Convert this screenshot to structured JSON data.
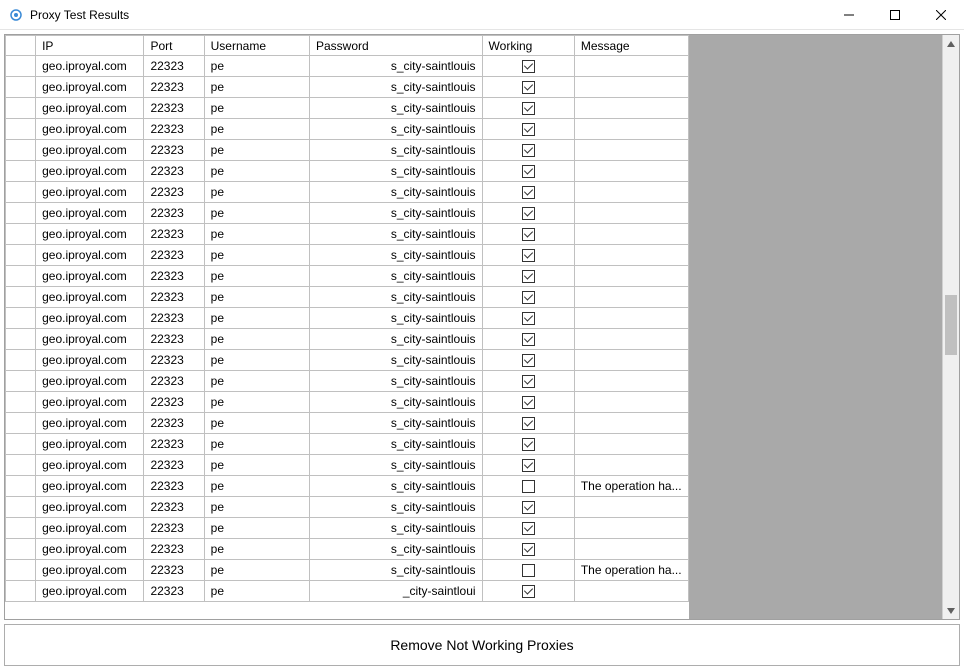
{
  "window": {
    "title": "Proxy Test Results"
  },
  "table": {
    "headers": {
      "ip": "IP",
      "port": "Port",
      "username": "Username",
      "password": "Password",
      "working": "Working",
      "message": "Message"
    },
    "rows": [
      {
        "ip": "geo.iproyal.com",
        "port": "22323",
        "username_visible": "pe",
        "password_visible": "s_city-saintlouis",
        "working": true,
        "message": ""
      },
      {
        "ip": "geo.iproyal.com",
        "port": "22323",
        "username_visible": "pe",
        "password_visible": "s_city-saintlouis",
        "working": true,
        "message": ""
      },
      {
        "ip": "geo.iproyal.com",
        "port": "22323",
        "username_visible": "pe",
        "password_visible": "s_city-saintlouis",
        "working": true,
        "message": ""
      },
      {
        "ip": "geo.iproyal.com",
        "port": "22323",
        "username_visible": "pe",
        "password_visible": "s_city-saintlouis",
        "working": true,
        "message": ""
      },
      {
        "ip": "geo.iproyal.com",
        "port": "22323",
        "username_visible": "pe",
        "password_visible": "s_city-saintlouis",
        "working": true,
        "message": ""
      },
      {
        "ip": "geo.iproyal.com",
        "port": "22323",
        "username_visible": "pe",
        "password_visible": "s_city-saintlouis",
        "working": true,
        "message": ""
      },
      {
        "ip": "geo.iproyal.com",
        "port": "22323",
        "username_visible": "pe",
        "password_visible": "s_city-saintlouis",
        "working": true,
        "message": ""
      },
      {
        "ip": "geo.iproyal.com",
        "port": "22323",
        "username_visible": "pe",
        "password_visible": "s_city-saintlouis",
        "working": true,
        "message": ""
      },
      {
        "ip": "geo.iproyal.com",
        "port": "22323",
        "username_visible": "pe",
        "password_visible": "s_city-saintlouis",
        "working": true,
        "message": ""
      },
      {
        "ip": "geo.iproyal.com",
        "port": "22323",
        "username_visible": "pe",
        "password_visible": "s_city-saintlouis",
        "working": true,
        "message": ""
      },
      {
        "ip": "geo.iproyal.com",
        "port": "22323",
        "username_visible": "pe",
        "password_visible": "s_city-saintlouis",
        "working": true,
        "message": ""
      },
      {
        "ip": "geo.iproyal.com",
        "port": "22323",
        "username_visible": "pe",
        "password_visible": "s_city-saintlouis",
        "working": true,
        "message": ""
      },
      {
        "ip": "geo.iproyal.com",
        "port": "22323",
        "username_visible": "pe",
        "password_visible": "s_city-saintlouis",
        "working": true,
        "message": ""
      },
      {
        "ip": "geo.iproyal.com",
        "port": "22323",
        "username_visible": "pe",
        "password_visible": "s_city-saintlouis",
        "working": true,
        "message": ""
      },
      {
        "ip": "geo.iproyal.com",
        "port": "22323",
        "username_visible": "pe",
        "password_visible": "s_city-saintlouis",
        "working": true,
        "message": ""
      },
      {
        "ip": "geo.iproyal.com",
        "port": "22323",
        "username_visible": "pe",
        "password_visible": "s_city-saintlouis",
        "working": true,
        "message": ""
      },
      {
        "ip": "geo.iproyal.com",
        "port": "22323",
        "username_visible": "pe",
        "password_visible": "s_city-saintlouis",
        "working": true,
        "message": ""
      },
      {
        "ip": "geo.iproyal.com",
        "port": "22323",
        "username_visible": "pe",
        "password_visible": "s_city-saintlouis",
        "working": true,
        "message": ""
      },
      {
        "ip": "geo.iproyal.com",
        "port": "22323",
        "username_visible": "pe",
        "password_visible": "s_city-saintlouis",
        "working": true,
        "message": ""
      },
      {
        "ip": "geo.iproyal.com",
        "port": "22323",
        "username_visible": "pe",
        "password_visible": "s_city-saintlouis",
        "working": true,
        "message": ""
      },
      {
        "ip": "geo.iproyal.com",
        "port": "22323",
        "username_visible": "pe",
        "password_visible": "s_city-saintlouis",
        "working": false,
        "message": "The operation ha..."
      },
      {
        "ip": "geo.iproyal.com",
        "port": "22323",
        "username_visible": "pe",
        "password_visible": "s_city-saintlouis",
        "working": true,
        "message": ""
      },
      {
        "ip": "geo.iproyal.com",
        "port": "22323",
        "username_visible": "pe",
        "password_visible": "s_city-saintlouis",
        "working": true,
        "message": ""
      },
      {
        "ip": "geo.iproyal.com",
        "port": "22323",
        "username_visible": "pe",
        "password_visible": "s_city-saintlouis",
        "working": true,
        "message": ""
      },
      {
        "ip": "geo.iproyal.com",
        "port": "22323",
        "username_visible": "pe",
        "password_visible": "s_city-saintlouis",
        "working": false,
        "message": "The operation ha..."
      },
      {
        "ip": "geo.iproyal.com",
        "port": "22323",
        "username_visible": "pe",
        "password_visible": "_city-saintloui",
        "working": true,
        "message": ""
      }
    ]
  },
  "button": {
    "remove_label": "Remove Not Working Proxies"
  }
}
